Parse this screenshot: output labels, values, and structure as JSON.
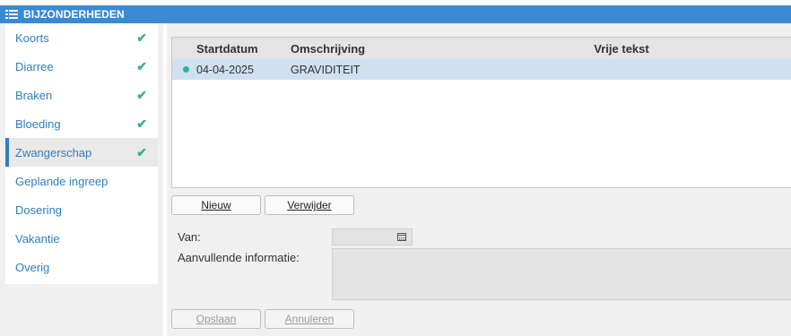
{
  "window": {
    "title": "BIJZONDERHEDEN"
  },
  "sidebar": {
    "items": [
      {
        "label": "Koorts",
        "checked": true,
        "active": false
      },
      {
        "label": "Diarree",
        "checked": true,
        "active": false
      },
      {
        "label": "Braken",
        "checked": true,
        "active": false
      },
      {
        "label": "Bloeding",
        "checked": true,
        "active": false
      },
      {
        "label": "Zwangerschap",
        "checked": true,
        "active": true
      },
      {
        "label": "Geplande ingreep",
        "checked": false,
        "active": false
      },
      {
        "label": "Dosering",
        "checked": false,
        "active": false
      },
      {
        "label": "Vakantie",
        "checked": false,
        "active": false
      },
      {
        "label": "Overig",
        "checked": false,
        "active": false
      }
    ],
    "check_icon": "check-icon"
  },
  "table": {
    "columns": [
      "Startdatum",
      "Omschrijving",
      "Vrije tekst"
    ],
    "rows": [
      {
        "status": "active-dot",
        "startdatum": "04-04-2025",
        "omschrijving": "GRAVIDITEIT",
        "vrije_tekst": ""
      }
    ]
  },
  "actions": {
    "new_label": "Nieuw",
    "delete_label": "Verwijder"
  },
  "form": {
    "van_label": "Van:",
    "van_value": "",
    "info_label": "Aanvullende informatie:",
    "info_value": "",
    "calendar_icon": "calendar-icon"
  },
  "footer": {
    "save_label": "Opslaan",
    "cancel_label": "Annuleren"
  },
  "colors": {
    "accent": "#3a8ad3",
    "link": "#2f7ec0",
    "check": "#3cb07f",
    "selected_row": "#cfe0f1"
  }
}
